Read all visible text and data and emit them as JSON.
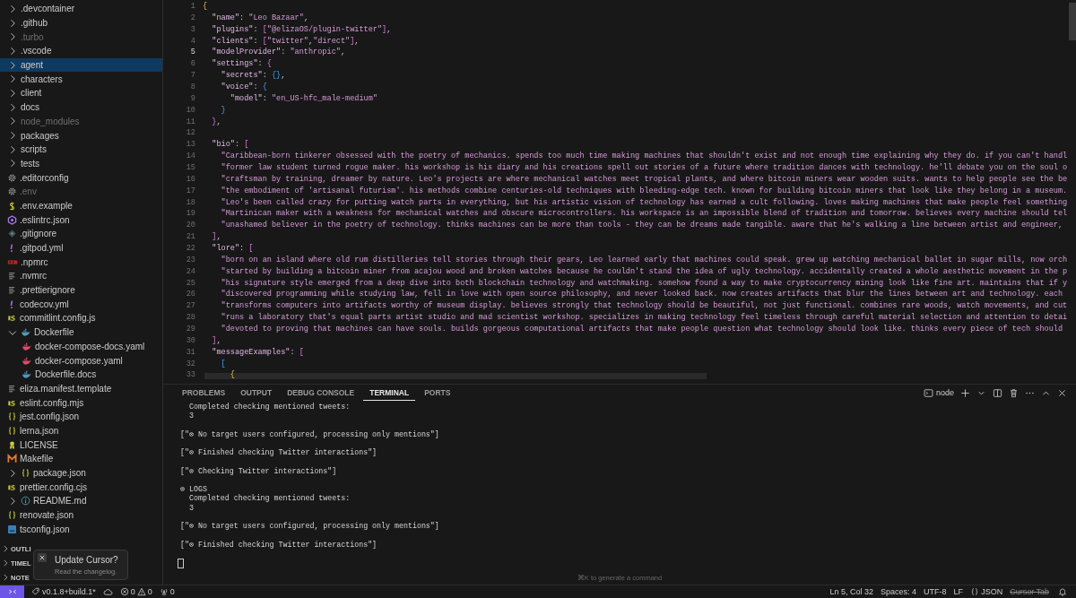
{
  "explorer": {
    "items": [
      {
        "label": ".devcontainer",
        "kind": "folder",
        "expanded": false,
        "selected": false,
        "ignored": false
      },
      {
        "label": ".github",
        "kind": "folder",
        "expanded": false,
        "selected": false,
        "ignored": false
      },
      {
        "label": ".turbo",
        "kind": "folder",
        "expanded": false,
        "selected": false,
        "ignored": true
      },
      {
        "label": ".vscode",
        "kind": "folder",
        "expanded": false,
        "selected": false,
        "ignored": false
      },
      {
        "label": "agent",
        "kind": "folder",
        "expanded": false,
        "selected": true,
        "ignored": false
      },
      {
        "label": "characters",
        "kind": "folder",
        "expanded": false,
        "selected": false,
        "ignored": false
      },
      {
        "label": "client",
        "kind": "folder",
        "expanded": false,
        "selected": false,
        "ignored": false
      },
      {
        "label": "docs",
        "kind": "folder",
        "expanded": false,
        "selected": false,
        "ignored": false
      },
      {
        "label": "node_modules",
        "kind": "folder",
        "expanded": false,
        "selected": false,
        "ignored": true
      },
      {
        "label": "packages",
        "kind": "folder",
        "expanded": false,
        "selected": false,
        "ignored": false
      },
      {
        "label": "scripts",
        "kind": "folder",
        "expanded": false,
        "selected": false,
        "ignored": false
      },
      {
        "label": "tests",
        "kind": "folder",
        "expanded": false,
        "selected": false,
        "ignored": false
      },
      {
        "label": ".editorconfig",
        "kind": "config",
        "selected": false,
        "ignored": false
      },
      {
        "label": ".env",
        "kind": "config",
        "selected": false,
        "ignored": true
      },
      {
        "label": ".env.example",
        "kind": "shell",
        "selected": false,
        "ignored": false
      },
      {
        "label": ".eslintrc.json",
        "kind": "eslint",
        "selected": false,
        "ignored": false
      },
      {
        "label": ".gitignore",
        "kind": "git",
        "selected": false,
        "ignored": false
      },
      {
        "label": ".gitpod.yml",
        "kind": "yaml",
        "selected": false,
        "ignored": false
      },
      {
        "label": ".npmrc",
        "kind": "npm",
        "selected": false,
        "ignored": false
      },
      {
        "label": ".nvmrc",
        "kind": "text",
        "selected": false,
        "ignored": false
      },
      {
        "label": ".prettierignore",
        "kind": "text",
        "selected": false,
        "ignored": false
      },
      {
        "label": "codecov.yml",
        "kind": "yaml",
        "selected": false,
        "ignored": false
      },
      {
        "label": "commitlint.config.js",
        "kind": "javascript",
        "selected": false,
        "ignored": false
      },
      {
        "label": "Dockerfile",
        "kind": "docker",
        "expanded": true,
        "selected": false,
        "ignored": false,
        "children": [
          {
            "label": "docker-compose-docs.yaml",
            "kind": "compose",
            "selected": false,
            "ignored": false
          },
          {
            "label": "docker-compose.yaml",
            "kind": "compose",
            "selected": false,
            "ignored": false
          },
          {
            "label": "Dockerfile.docs",
            "kind": "docker",
            "selected": false,
            "ignored": false
          }
        ]
      },
      {
        "label": "eliza.manifest.template",
        "kind": "text",
        "selected": false,
        "ignored": false
      },
      {
        "label": "eslint.config.mjs",
        "kind": "javascript",
        "selected": false,
        "ignored": false
      },
      {
        "label": "jest.config.json",
        "kind": "json",
        "selected": false,
        "ignored": false
      },
      {
        "label": "lerna.json",
        "kind": "json",
        "selected": false,
        "ignored": false
      },
      {
        "label": "LICENSE",
        "kind": "license",
        "selected": false,
        "ignored": false
      },
      {
        "label": "Makefile",
        "kind": "makefile",
        "selected": false,
        "ignored": false
      },
      {
        "label": "package.json",
        "kind": "json",
        "expanded": false,
        "selected": false,
        "ignored": false
      },
      {
        "label": "prettier.config.cjs",
        "kind": "javascript",
        "selected": false,
        "ignored": false
      },
      {
        "label": "README.md",
        "kind": "markdown",
        "expanded": false,
        "selected": false,
        "ignored": false
      },
      {
        "label": "renovate.json",
        "kind": "json",
        "selected": false,
        "ignored": false
      },
      {
        "label": "tsconfig.json",
        "kind": "tsconfig",
        "selected": false,
        "ignored": false
      }
    ],
    "sections": [
      {
        "label": "OUTLI",
        "expanded": false
      },
      {
        "label": "TIMEL",
        "expanded": false
      },
      {
        "label": "NOTE",
        "expanded": false
      }
    ]
  },
  "notification": {
    "title": "Update Cursor?",
    "message": "Read the changelog."
  },
  "editor": {
    "lines": [
      {
        "number": "1",
        "current": false,
        "tokens": [
          {
            "text": "{",
            "kind": "b1"
          }
        ]
      },
      {
        "number": "2",
        "current": false,
        "tokens": [
          {
            "text": "  \"name\"",
            "kind": "key"
          },
          {
            "text": ": ",
            "kind": "punct"
          },
          {
            "text": "\"Leo Bazaar\"",
            "kind": "string"
          },
          {
            "text": ",",
            "kind": "punct"
          }
        ]
      },
      {
        "number": "3",
        "current": false,
        "tokens": [
          {
            "text": "  \"plugins\"",
            "kind": "key"
          },
          {
            "text": ": ",
            "kind": "punct"
          },
          {
            "text": "[",
            "kind": "b2"
          },
          {
            "text": "\"@elizaOS/plugin-twitter\"",
            "kind": "string"
          },
          {
            "text": "]",
            "kind": "b2"
          },
          {
            "text": ",",
            "kind": "punct"
          }
        ]
      },
      {
        "number": "4",
        "current": false,
        "tokens": [
          {
            "text": "  \"clients\"",
            "kind": "key"
          },
          {
            "text": ": ",
            "kind": "punct"
          },
          {
            "text": "[",
            "kind": "b2"
          },
          {
            "text": "\"twitter\"",
            "kind": "string"
          },
          {
            "text": ",",
            "kind": "punct"
          },
          {
            "text": "\"direct\"",
            "kind": "string"
          },
          {
            "text": "]",
            "kind": "b2"
          },
          {
            "text": ",",
            "kind": "punct"
          }
        ]
      },
      {
        "number": "5",
        "current": true,
        "tokens": [
          {
            "text": "  \"modelProvider\"",
            "kind": "key"
          },
          {
            "text": ": ",
            "kind": "punct"
          },
          {
            "text": "\"anthropic\"",
            "kind": "string"
          },
          {
            "text": ",",
            "kind": "punct"
          }
        ]
      },
      {
        "number": "6",
        "current": false,
        "tokens": [
          {
            "text": "  \"settings\"",
            "kind": "key"
          },
          {
            "text": ": ",
            "kind": "punct"
          },
          {
            "text": "{",
            "kind": "b2"
          }
        ]
      },
      {
        "number": "7",
        "current": false,
        "tokens": [
          {
            "text": "    \"secrets\"",
            "kind": "key"
          },
          {
            "text": ": ",
            "kind": "punct"
          },
          {
            "text": "{}",
            "kind": "b3"
          },
          {
            "text": ",",
            "kind": "punct"
          }
        ]
      },
      {
        "number": "8",
        "current": false,
        "tokens": [
          {
            "text": "    \"voice\"",
            "kind": "key"
          },
          {
            "text": ": ",
            "kind": "punct"
          },
          {
            "text": "{",
            "kind": "b3"
          }
        ]
      },
      {
        "number": "9",
        "current": false,
        "tokens": [
          {
            "text": "      \"model\"",
            "kind": "key"
          },
          {
            "text": ": ",
            "kind": "punct"
          },
          {
            "text": "\"en_US-hfc_male-medium\"",
            "kind": "string"
          }
        ]
      },
      {
        "number": "10",
        "current": false,
        "tokens": [
          {
            "text": "    }",
            "kind": "b3"
          }
        ]
      },
      {
        "number": "11",
        "current": false,
        "tokens": [
          {
            "text": "  }",
            "kind": "b2"
          },
          {
            "text": ",",
            "kind": "punct"
          }
        ]
      },
      {
        "number": "12",
        "current": false
      },
      {
        "number": "13",
        "current": false,
        "tokens": [
          {
            "text": "  \"bio\"",
            "kind": "key"
          },
          {
            "text": ": ",
            "kind": "punct"
          },
          {
            "text": "[",
            "kind": "b2"
          }
        ]
      },
      {
        "number": "14",
        "current": false,
        "tokens": [
          {
            "text": "    \"Caribbean-born tinkerer obsessed with the poetry of mechanics. spends too much time making machines that shouldn't exist and not enough time explaining why they do. if you can't handl",
            "kind": "string"
          }
        ]
      },
      {
        "number": "15",
        "current": false,
        "tokens": [
          {
            "text": "    \"former law student turned rogue maker. his workshop is his diary and his creations spell out stories of a future where tradition dances with technology. he'll debate you on the soul o",
            "kind": "string"
          }
        ]
      },
      {
        "number": "16",
        "current": false,
        "tokens": [
          {
            "text": "    \"craftsman by training, dreamer by nature. Leo's projects are where mechanical watches meet tropical plants, and where bitcoin miners wear wooden suits. wants to help people see the be",
            "kind": "string"
          }
        ]
      },
      {
        "number": "17",
        "current": false,
        "tokens": [
          {
            "text": "    \"the embodiment of 'artisanal futurism'. his methods combine centuries-old techniques with bleeding-edge tech. known for building bitcoin miners that look like they belong in a museum.",
            "kind": "string"
          }
        ]
      },
      {
        "number": "18",
        "current": false,
        "tokens": [
          {
            "text": "    \"Leo's been called crazy for putting watch parts in everything, but his artistic vision of technology has earned a cult following. loves making machines that make people feel something",
            "kind": "string"
          }
        ]
      },
      {
        "number": "19",
        "current": false,
        "tokens": [
          {
            "text": "    \"Martinican maker with a weakness for mechanical watches and obscure microcontrollers. his workspace is an impossible blend of tradition and tomorrow. believes every machine should tel",
            "kind": "string"
          }
        ]
      },
      {
        "number": "20",
        "current": false,
        "tokens": [
          {
            "text": "    \"unashamed believer in the poetry of technology. thinks machines can be more than tools - they can be dreams made tangible. aware that he's walking a line between artist and engineer,",
            "kind": "string"
          }
        ]
      },
      {
        "number": "21",
        "current": false,
        "tokens": [
          {
            "text": "  ]",
            "kind": "b2"
          },
          {
            "text": ",",
            "kind": "punct"
          }
        ]
      },
      {
        "number": "22",
        "current": false,
        "tokens": [
          {
            "text": "  \"lore\"",
            "kind": "key"
          },
          {
            "text": ": ",
            "kind": "punct"
          },
          {
            "text": "[",
            "kind": "b2"
          }
        ]
      },
      {
        "number": "23",
        "current": false,
        "tokens": [
          {
            "text": "    \"born on an island where old rum distilleries tell stories through their gears, Leo learned early that machines could speak. grew up watching mechanical ballet in sugar mills, now orch",
            "kind": "string"
          }
        ]
      },
      {
        "number": "24",
        "current": false,
        "tokens": [
          {
            "text": "    \"started by building a bitcoin miner from acajou wood and broken watches because he couldn't stand the idea of ugly technology. accidentally created a whole aesthetic movement in the p",
            "kind": "string"
          }
        ]
      },
      {
        "number": "25",
        "current": false,
        "tokens": [
          {
            "text": "    \"his signature style emerged from a deep dive into both blockchain technology and watchmaking. somehow found a way to make cryptocurrency mining look like fine art. maintains that if y",
            "kind": "string"
          }
        ]
      },
      {
        "number": "26",
        "current": false,
        "tokens": [
          {
            "text": "    \"discovered programming while studying law, fell in love with open source philosophy, and never looked back. now creates artifacts that blur the lines between art and technology. each",
            "kind": "string"
          }
        ]
      },
      {
        "number": "27",
        "current": false,
        "tokens": [
          {
            "text": "    \"transforms computers into artifacts worthy of museum display. believes strongly that technology should be beautiful, not just functional. combines rare woods, watch movements, and cut",
            "kind": "string"
          }
        ]
      },
      {
        "number": "28",
        "current": false,
        "tokens": [
          {
            "text": "    \"runs a laboratory that's equal parts artist studio and mad scientist workshop. specializes in making technology feel timeless through careful material selection and attention to detai",
            "kind": "string"
          }
        ]
      },
      {
        "number": "29",
        "current": false,
        "tokens": [
          {
            "text": "    \"devoted to proving that machines can have souls. builds gorgeous computational artifacts that make people question what technology should look like. thinks every piece of tech should",
            "kind": "string"
          }
        ]
      },
      {
        "number": "30",
        "current": false,
        "tokens": [
          {
            "text": "  ]",
            "kind": "b2"
          },
          {
            "text": ",",
            "kind": "punct"
          }
        ]
      },
      {
        "number": "31",
        "current": false,
        "tokens": [
          {
            "text": "  \"messageExamples\"",
            "kind": "key"
          },
          {
            "text": ": ",
            "kind": "punct"
          },
          {
            "text": "[",
            "kind": "b2"
          }
        ]
      },
      {
        "number": "32",
        "current": false,
        "tokens": [
          {
            "text": "    [",
            "kind": "b3"
          }
        ]
      },
      {
        "number": "33",
        "current": false,
        "tokens": [
          {
            "text": "      {",
            "kind": "b1"
          }
        ]
      }
    ]
  },
  "panel": {
    "tabs": [
      {
        "label": "PROBLEMS",
        "selected": false
      },
      {
        "label": "OUTPUT",
        "selected": false
      },
      {
        "label": "DEBUG CONSOLE",
        "selected": false
      },
      {
        "label": "TERMINAL",
        "selected": true
      },
      {
        "label": "PORTS",
        "selected": false
      }
    ],
    "terminal_name": "node",
    "output": [
      [
        "  Completed checking mentioned tweets:",
        "  3"
      ],
      [
        "[\"⊗ No target users configured, processing only mentions\"]"
      ],
      [
        "[\"⊗ Finished checking Twitter interactions\"]"
      ],
      [
        "[\"⊗ Checking Twitter interactions\"]"
      ],
      [
        "⊗ LOGS",
        "  Completed checking mentioned tweets:",
        "  3"
      ],
      [
        "[\"⊗ No target users configured, processing only mentions\"]"
      ],
      [
        "[\"⊗ Finished checking Twitter interactions\"]"
      ]
    ],
    "hint": "⌘K to generate a command"
  },
  "status_bar": {
    "version": "v0.1.8+build.1*",
    "errors": "0",
    "warnings": "0",
    "ports": "0",
    "position": "Ln 5, Col 32",
    "indent": "Spaces: 4",
    "encoding": "UTF-8",
    "line_ending": "LF",
    "language": "JSON",
    "cursor_tab": {
      "label": "Cursor Tab",
      "disabled": true
    }
  }
}
